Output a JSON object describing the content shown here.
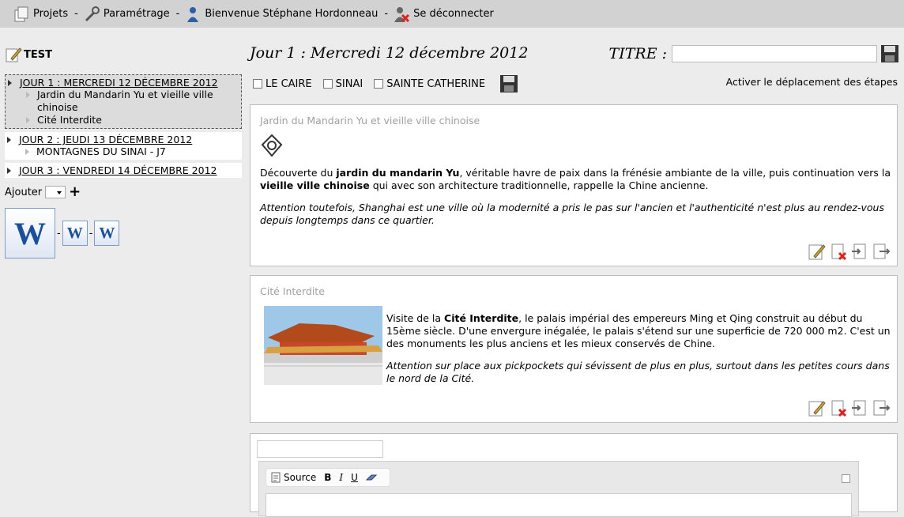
{
  "topbar": {
    "projets": "Projets",
    "parametrage": "Paramétrage",
    "welcome": "Bienvenue Stéphane Hordonneau",
    "logout": "Se déconnecter",
    "sep": "-"
  },
  "sidebar": {
    "project": "TEST",
    "days": [
      {
        "label": "JOUR 1 : MERCREDI 12 DÉCEMBRE 2012",
        "steps": [
          "Jardin du Mandarin Yu et vieille ville chinoise",
          "Cité Interdite"
        ]
      },
      {
        "label": "JOUR 2 : JEUDI 13 DÉCEMBRE 2012",
        "steps": [
          "MONTAGNES DU SINAI - J7"
        ]
      },
      {
        "label": "JOUR 3 : VENDREDI 14 DÉCEMBRE 2012",
        "steps": []
      }
    ],
    "add_label": "Ajouter",
    "plus": "+",
    "word_letter": "W",
    "dash": "-"
  },
  "main": {
    "day_title": "Jour 1 : Mercredi 12 décembre 2012",
    "titre_label": "TITRE :",
    "titre_value": "",
    "checkboxes": [
      "LE CAIRE",
      "SINAI",
      "SAINTE CATHERINE"
    ],
    "activer": "Activer le déplacement des étapes",
    "card1": {
      "title": "Jardin du Mandarin Yu et vieille ville chinoise",
      "t1": "Découverte du ",
      "b1": "jardin du mandarin Yu",
      "t2": ", véritable havre de paix dans la frénésie ambiante de la ville, puis continuation vers la ",
      "b2": "vieille ville chinoise",
      "t3": " qui avec son architecture traditionnelle, rappelle la Chine ancienne.",
      "note": "Attention toutefois, Shanghai est une ville où la modernité a pris le pas sur l'ancien et l'authenticité n'est plus au rendez-vous depuis longtemps dans ce quartier."
    },
    "card2": {
      "title": "Cité Interdite",
      "t1": "Visite de la ",
      "b1": "Cité Interdite",
      "t2": ", le palais impérial des empereurs Ming et Qing construit au début du 15ème siècle. D'une envergure inégalée, le palais s'étend sur une superficie de 720 000 m2. C'est un des monuments les plus anciens et les mieux conservés de Chine.",
      "note": "Attention sur place aux pickpockets qui sévissent de plus en plus, surtout dans les petites cours dans le nord de la Cité."
    },
    "editor": {
      "source": "Source",
      "bold": "B",
      "italic": "I",
      "underline": "U"
    }
  },
  "colors": {
    "topbar": "#d2d2d2",
    "background": "#ececec",
    "active_day": "#dcdcdc"
  }
}
